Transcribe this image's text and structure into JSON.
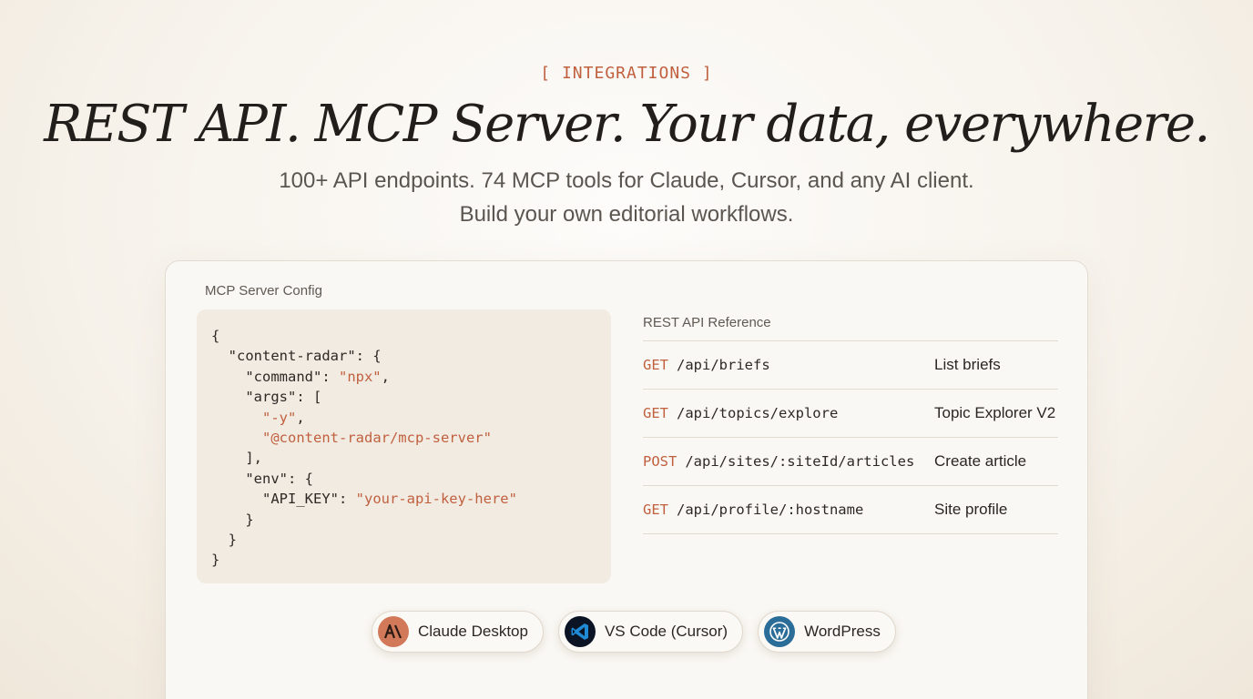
{
  "header": {
    "eyebrow": "[ INTEGRATIONS ]",
    "title": "REST API. MCP Server. Your data, everywhere.",
    "subtitle_line1": "100+ API endpoints. 74 MCP tools for Claude, Cursor, and any AI client.",
    "subtitle_line2": "Build your own editorial workflows."
  },
  "mcp_config": {
    "label": "MCP Server Config",
    "code": {
      "open_brace": "{",
      "server_key": "\"content-radar\": {",
      "command_key": "\"command\": ",
      "command_value": "\"npx\"",
      "args_key": "\"args\": [",
      "arg1": "\"-y\"",
      "arg2": "\"@content-radar/mcp-server\"",
      "args_close": "],",
      "env_key": "\"env\": {",
      "api_key_key": "\"API_KEY\": ",
      "api_key_value": "\"your-api-key-here\"",
      "env_close": "}",
      "server_close": "}",
      "close_brace": "}"
    }
  },
  "api_reference": {
    "label": "REST API Reference",
    "rows": [
      {
        "method": "GET",
        "path": "/api/briefs",
        "description": "List briefs"
      },
      {
        "method": "GET",
        "path": "/api/topics/explore",
        "description": "Topic Explorer V2"
      },
      {
        "method": "POST",
        "path": "/api/sites/:siteId/articles",
        "description": "Create article"
      },
      {
        "method": "GET",
        "path": "/api/profile/:hostname",
        "description": "Site profile"
      }
    ]
  },
  "integrations": [
    {
      "label": "Claude Desktop",
      "icon": "claude-icon"
    },
    {
      "label": "VS Code (Cursor)",
      "icon": "vscode-icon"
    },
    {
      "label": "WordPress",
      "icon": "wordpress-icon"
    }
  ],
  "colors": {
    "accent": "#c0603f",
    "background": "#f7f3ec",
    "card": "#faf8f4",
    "code_bg": "#f2ebe2"
  }
}
